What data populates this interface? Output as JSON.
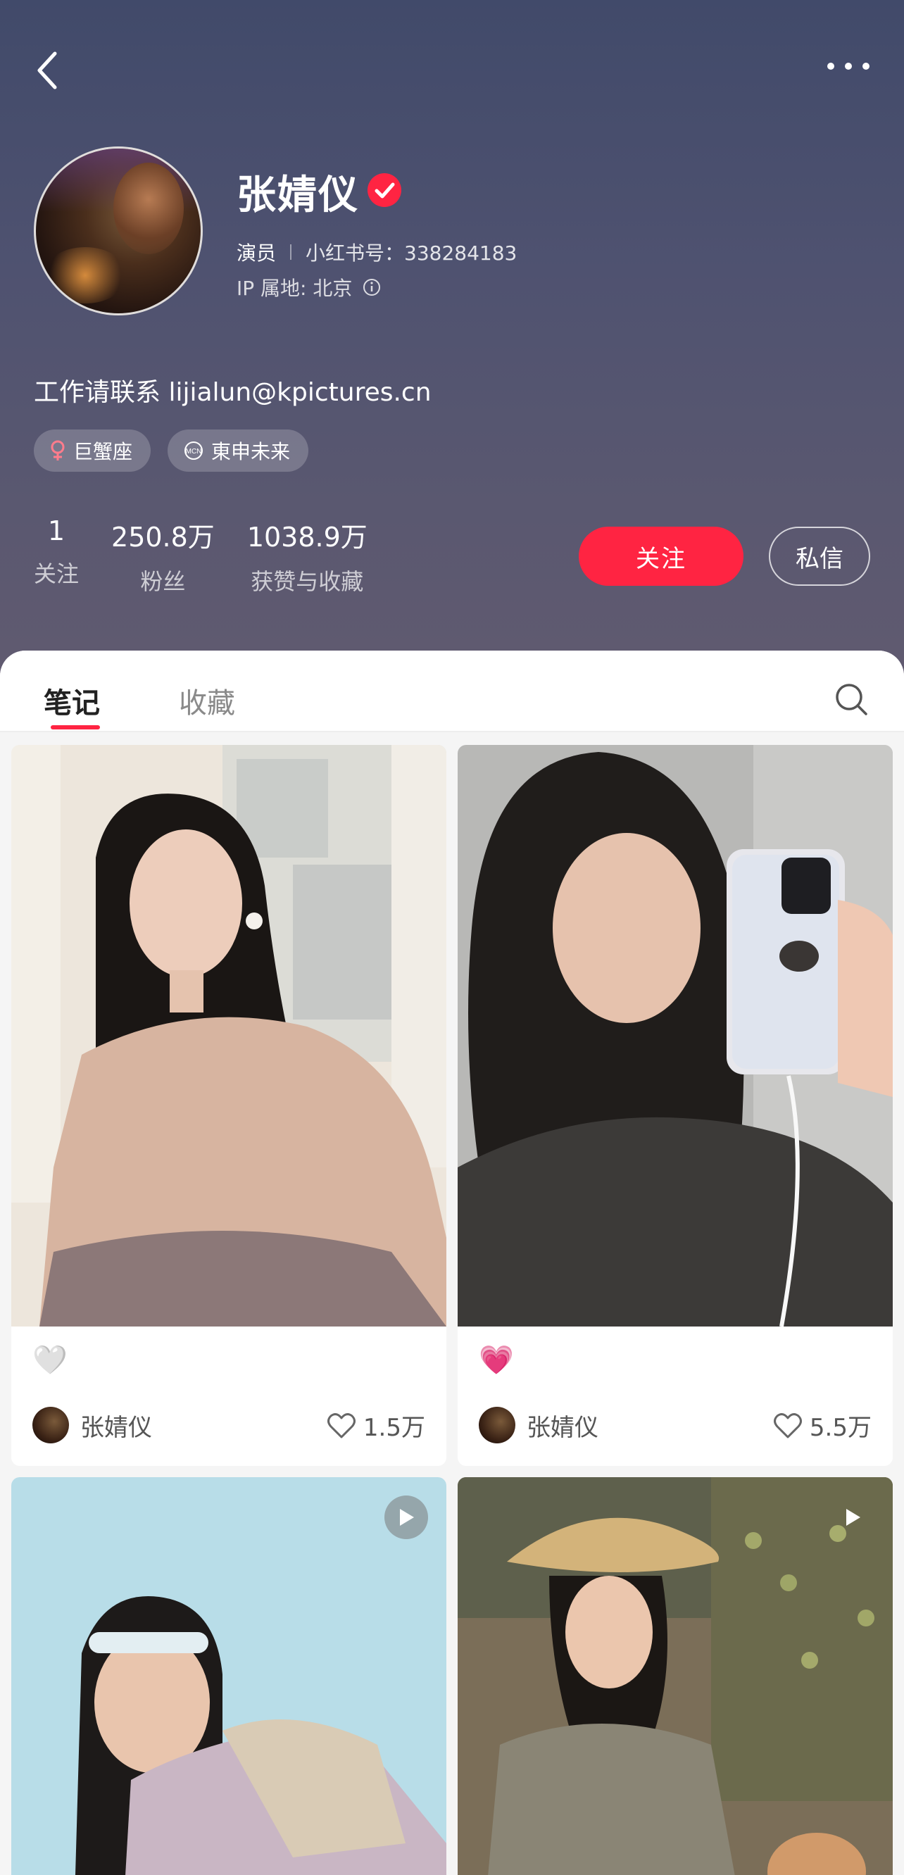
{
  "profile": {
    "name": "张婧仪",
    "role": "演员",
    "account_id": "小红书号：338284183",
    "ip_location": "IP 属地: 北京",
    "bio": "工作请联系 lijialun@kpictures.cn",
    "tags": [
      {
        "label": "巨蟹座",
        "icon": "female-icon"
      },
      {
        "label": "東申未来",
        "icon": "mcn-icon"
      }
    ]
  },
  "stats": [
    {
      "value": "1",
      "label": "关注"
    },
    {
      "value": "250.8万",
      "label": "粉丝"
    },
    {
      "value": "1038.9万",
      "label": "获赞与收藏"
    }
  ],
  "actions": {
    "follow_label": "关注",
    "message_label": "私信"
  },
  "tabs": [
    {
      "label": "笔记",
      "active": true
    },
    {
      "label": "收藏",
      "active": false
    }
  ],
  "notes": [
    {
      "emoji": "🤍",
      "author": "张婧仪",
      "likes": "1.5万",
      "has_video": false
    },
    {
      "emoji": "💗",
      "author": "张婧仪",
      "likes": "5.5万",
      "has_video": false
    },
    {
      "has_video": true
    },
    {
      "has_video": true
    }
  ],
  "colors": {
    "accent": "#ff2442",
    "header_top": "#414a6a",
    "header_bottom": "#605a70"
  }
}
